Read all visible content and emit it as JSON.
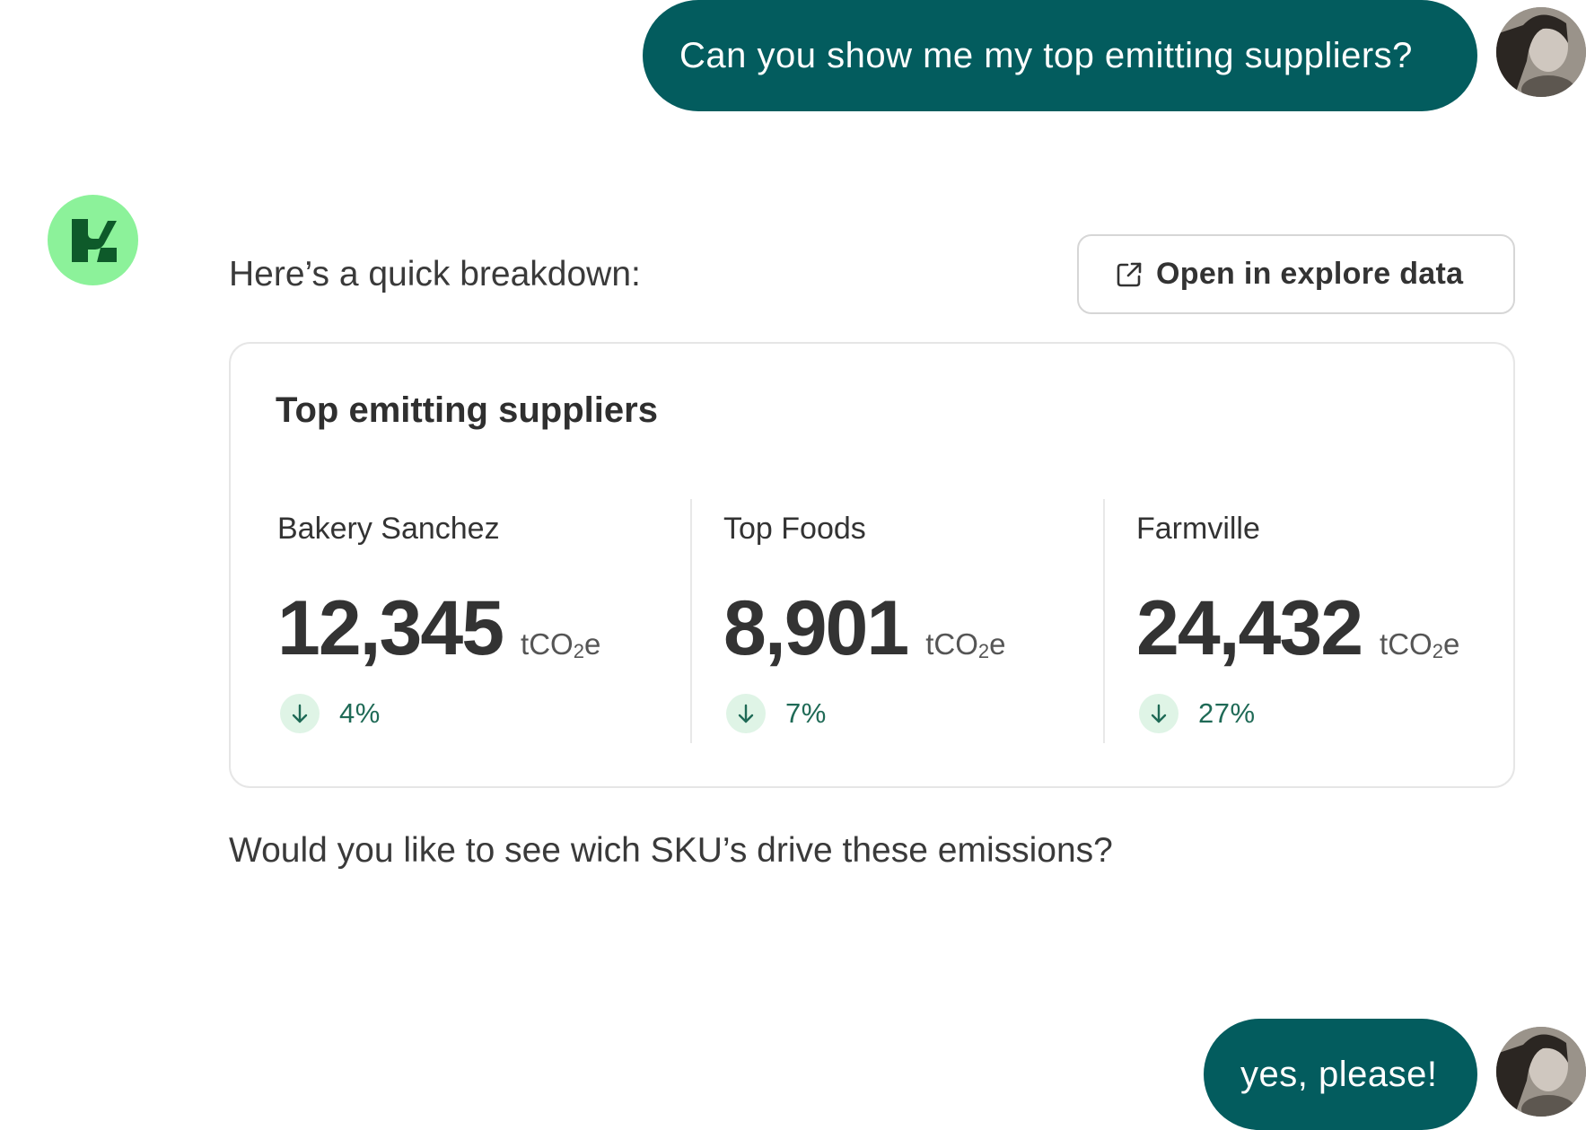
{
  "conversation": {
    "user_message_1": "Can you show me my top emitting suppliers?",
    "assistant_intro": "Here’s a quick breakdown:",
    "assistant_followup": "Would you like to see wich SKU’s drive these emissions?",
    "user_message_2": "yes, please!"
  },
  "actions": {
    "explore_label": "Open in explore data",
    "explore_icon": "external-link-icon"
  },
  "card": {
    "title": "Top emitting suppliers",
    "unit_prefix": "tCO",
    "unit_sub": "2",
    "unit_suffix": "e",
    "suppliers": [
      {
        "name": "Bakery Sanchez",
        "value": "12,345",
        "change": "4%",
        "direction": "down"
      },
      {
        "name": "Top Foods",
        "value": "8,901",
        "change": "7%",
        "direction": "down"
      },
      {
        "name": "Farmville",
        "value": "24,432",
        "change": "27%",
        "direction": "down"
      }
    ]
  },
  "colors": {
    "user_bubble": "#035c5e",
    "bot_logo_bg": "#8cf29a",
    "bot_logo_fg": "#0e5a2a",
    "change_text": "#1f6a56",
    "change_badge_bg": "#dff4e6"
  },
  "icons": {
    "user_avatar": "user-avatar-photo",
    "bot_logo": "assistant-logo-icon",
    "change_arrow": "arrow-down-icon"
  }
}
